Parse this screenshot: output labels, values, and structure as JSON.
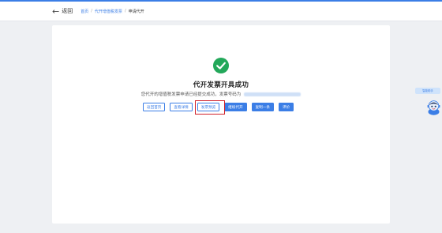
{
  "header": {
    "back_label": "返回",
    "breadcrumb": [
      "首页",
      "代开增值税发票",
      "申请代开"
    ]
  },
  "result": {
    "title": "代开发票开具成功",
    "message": "您代开的增值税发票申请已经提交成功，发票号码为"
  },
  "buttons": [
    "返回首页",
    "查看详情",
    "发票预览",
    "继续代开",
    "复制一条",
    "评价"
  ],
  "side_widget": {
    "tag_text": "智能助手"
  },
  "colors": {
    "accent": "#3b7ee6",
    "success": "#23a85a",
    "highlight": "#d0212a"
  },
  "icons": {
    "success": "check-circle-icon",
    "back": "arrow-left-icon",
    "assistant": "robot-avatar-icon"
  }
}
